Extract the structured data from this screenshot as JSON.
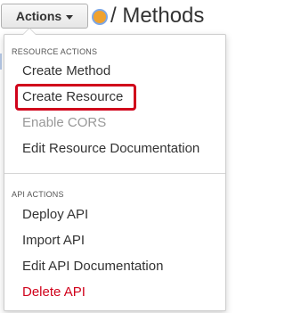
{
  "toolbar": {
    "actions_label": "Actions",
    "page_title": "/ Methods"
  },
  "menu": {
    "sections": [
      {
        "header": "RESOURCE ACTIONS",
        "items": [
          {
            "label": "Create Method",
            "state": "normal"
          },
          {
            "label": "Create Resource",
            "state": "highlighted"
          },
          {
            "label": "Enable CORS",
            "state": "disabled"
          },
          {
            "label": "Edit Resource Documentation",
            "state": "normal"
          }
        ]
      },
      {
        "header": "API ACTIONS",
        "items": [
          {
            "label": "Deploy API",
            "state": "normal"
          },
          {
            "label": "Import API",
            "state": "normal"
          },
          {
            "label": "Edit API Documentation",
            "state": "normal"
          },
          {
            "label": "Delete API",
            "state": "danger"
          }
        ]
      }
    ]
  },
  "colors": {
    "danger": "#d0021b",
    "disabled": "#999999",
    "text": "#333333",
    "status_dot": "#f0a22e"
  },
  "icons": {
    "caret": "caret-down-icon",
    "status": "status-dot-icon"
  }
}
